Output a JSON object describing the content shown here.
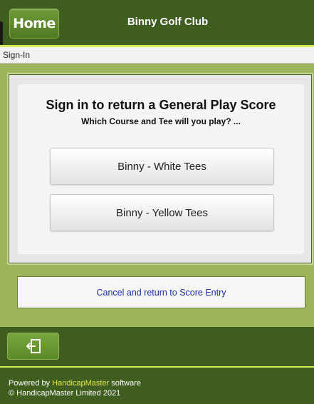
{
  "header": {
    "home_label": "Home",
    "title": "Binny Golf Club"
  },
  "breadcrumb": "Sign-In",
  "main": {
    "title": "Sign in to return a General Play Score",
    "subtitle": "Which Course and Tee will you play? ...",
    "tees": [
      {
        "label": "Binny - White Tees"
      },
      {
        "label": "Binny - Yellow Tees"
      }
    ]
  },
  "cancel_label": "Cancel and return to Score Entry",
  "footer": {
    "exit_icon": "exit-icon",
    "powered_prefix": "Powered by ",
    "brand": "HandicapMaster",
    "powered_suffix": " software",
    "copyright": "© HandicapMaster Limited 2021"
  },
  "colors": {
    "header_bg": "#3f5e1f",
    "accent_rule": "#d5ee58",
    "content_bg": "#9db45a",
    "link": "#1b2f9c",
    "brand_text": "#e3ea4a"
  }
}
